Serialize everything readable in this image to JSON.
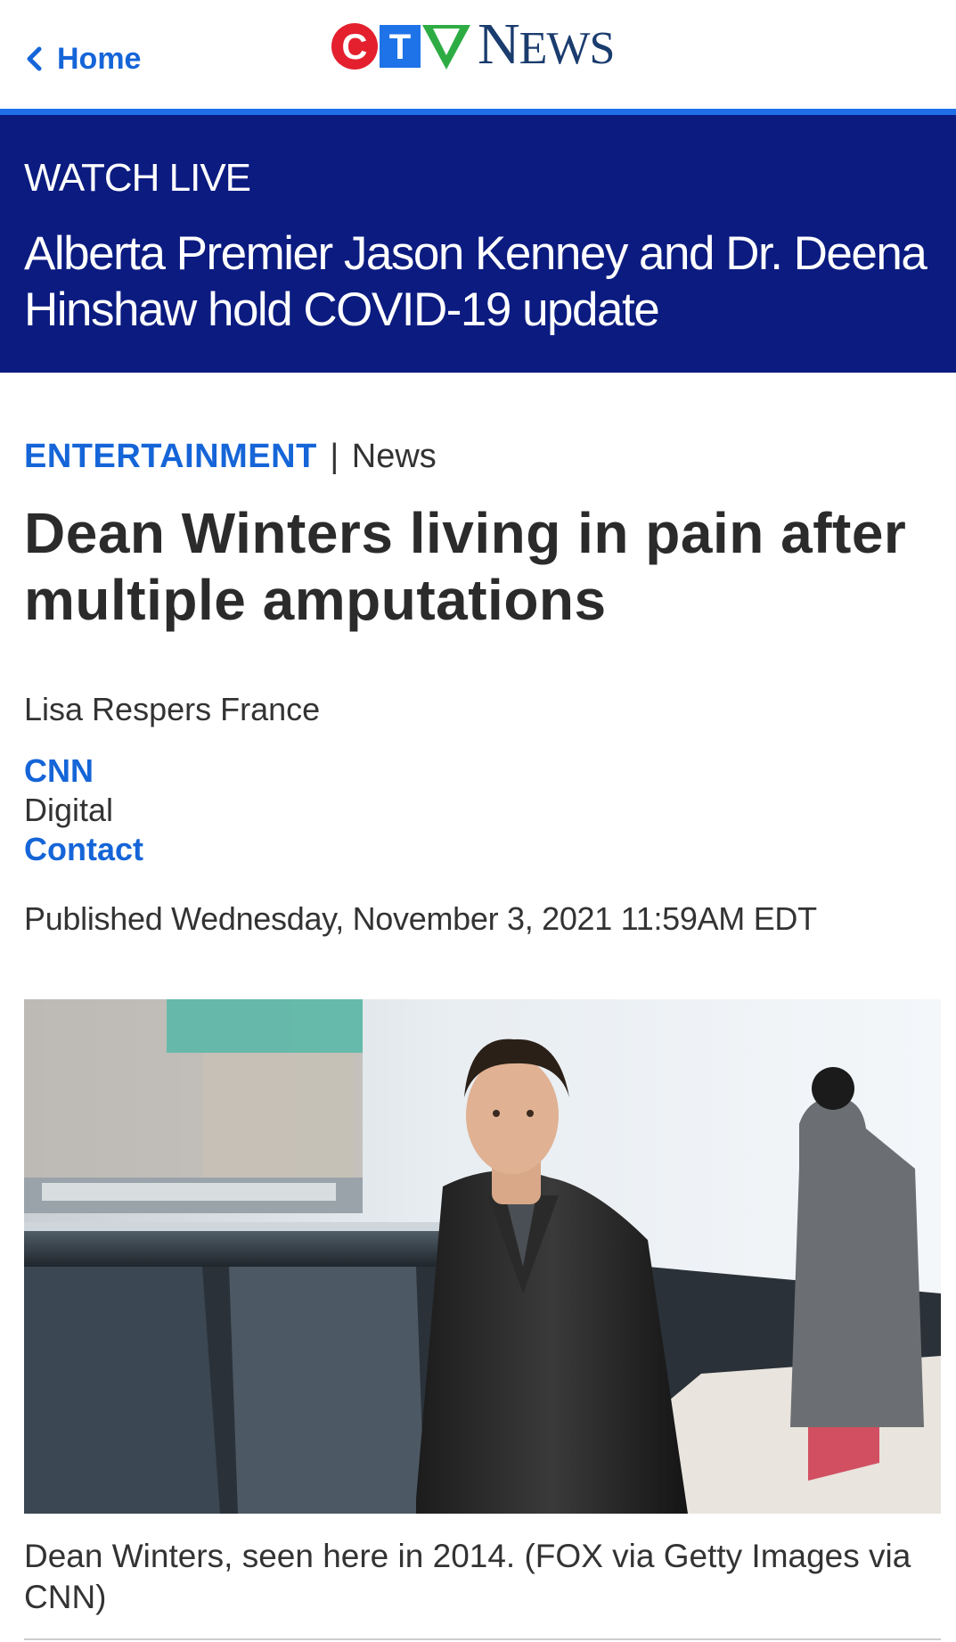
{
  "header": {
    "back_label": "Home",
    "logo": {
      "letters": [
        "C",
        "T",
        "V"
      ],
      "wordmark": "NEWS",
      "colors": {
        "c": "#e4202e",
        "t": "#1e73e8",
        "v": "#2eac44",
        "news": "#1a3c6e"
      }
    }
  },
  "banner": {
    "label": "WATCH LIVE",
    "headline": "Alberta Premier Jason Kenney and Dr. Deena Hinshaw hold COVID-19 update",
    "background": "#0b1b80"
  },
  "article": {
    "category": "ENTERTAINMENT",
    "separator": "|",
    "subcategory": "News",
    "title": "Dean Winters living in pain after multiple amputations",
    "author": "Lisa Respers France",
    "organization": "CNN",
    "department": "Digital",
    "contact_label": "Contact",
    "published": "Published Wednesday, November 3, 2021 11:59AM EDT",
    "image_caption": "Dean Winters, seen here in 2014. (FOX via Getty Images via CNN)"
  },
  "colors": {
    "accent": "#1565d8",
    "rule": "#1e6fe8",
    "text": "#333333"
  }
}
